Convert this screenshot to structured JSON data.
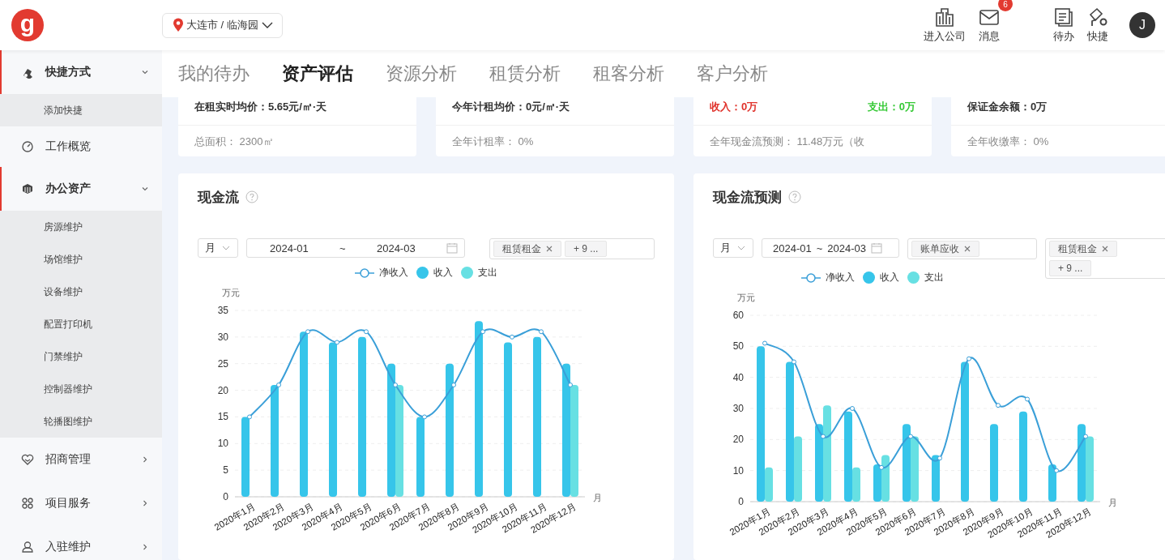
{
  "header": {
    "logo": "g",
    "location": "大连市 / 临海园",
    "actions": [
      {
        "label": "进入公司"
      },
      {
        "label": "消息",
        "badge": "6"
      },
      {
        "label": "待办"
      },
      {
        "label": "快捷"
      }
    ],
    "avatar": "J"
  },
  "sidebar": {
    "items": [
      {
        "kind": "group",
        "label": "快捷方式",
        "expanded": true,
        "children": [
          {
            "label": "添加快捷"
          }
        ]
      },
      {
        "kind": "link",
        "label": "工作概览"
      },
      {
        "kind": "group",
        "label": "办公资产",
        "expanded": true,
        "children": [
          {
            "label": "房源维护"
          },
          {
            "label": "场馆维护"
          },
          {
            "label": "设备维护"
          },
          {
            "label": "配置打印机"
          },
          {
            "label": "门禁维护"
          },
          {
            "label": "控制器维护"
          },
          {
            "label": "轮播图维护"
          }
        ]
      },
      {
        "kind": "group",
        "label": "招商管理",
        "expanded": false
      },
      {
        "kind": "group",
        "label": "项目服务",
        "expanded": false
      },
      {
        "kind": "group",
        "label": "入驻维护",
        "expanded": false
      }
    ]
  },
  "tabs": [
    {
      "label": "我的待办",
      "selected": false
    },
    {
      "label": "资产评估",
      "selected": true
    },
    {
      "label": "资源分析",
      "selected": false
    },
    {
      "label": "租赁分析",
      "selected": false
    },
    {
      "label": "租客分析",
      "selected": false
    },
    {
      "label": "客户分析",
      "selected": false
    }
  ],
  "stat_cards": [
    {
      "top": [
        {
          "text": "在租实时均价：5.65元/㎡·天",
          "color": "#333333"
        }
      ],
      "bottom": "总面积：  2300㎡"
    },
    {
      "top": [
        {
          "text": "今年计租均价：0元/㎡·天",
          "color": "#333333"
        }
      ],
      "bottom": "全年计租率：  0%"
    },
    {
      "top": [
        {
          "text": "收入：0万",
          "color": "#e0322b"
        },
        {
          "text": "支出：0万",
          "color": "#35c935"
        }
      ],
      "bottom": "全年现金流预测：  11.48万元（收"
    },
    {
      "top": [
        {
          "text": "保证金余额：0万",
          "color": "#333333"
        }
      ],
      "bottom": "全年收缴率：  0%"
    }
  ],
  "panels": [
    {
      "title": "现金流",
      "filters": [
        {
          "kind": "select",
          "value": "月"
        },
        {
          "kind": "range",
          "start": "2024-01",
          "separator": "~",
          "end": "2024-03",
          "wide": true
        },
        {
          "kind": "tags",
          "tags": [
            {
              "label": "租赁租金",
              "closable": true
            },
            {
              "label": "+ 9 ...",
              "closable": false
            }
          ],
          "wrap": false
        }
      ],
      "chart_data": {
        "type": "bar",
        "ylabel": "万元",
        "xlabel": "月",
        "grid": true,
        "categories": [
          "2020年1月",
          "2020年2月",
          "2020年3月",
          "2020年4月",
          "2020年5月",
          "2020年6月",
          "2020年7月",
          "2020年8月",
          "2020年9月",
          "2020年10月",
          "2020年11月",
          "2020年12月"
        ],
        "ylim": [
          0,
          35
        ],
        "yticks": [
          0,
          5,
          10,
          15,
          20,
          25,
          30,
          35
        ],
        "series": [
          {
            "name": "净收入",
            "type": "line",
            "marker": true,
            "color": "#3a9fd8",
            "values": [
              15,
              21,
              31,
              29,
              31,
              21,
              15,
              21,
              31,
              30,
              31,
              21
            ]
          },
          {
            "name": "收入",
            "type": "bar",
            "color": "#36c5ea",
            "values": [
              15,
              21,
              31,
              29,
              30,
              25,
              15,
              25,
              33,
              29,
              30,
              25
            ]
          },
          {
            "name": "支出",
            "type": "bar",
            "color": "#67e0e3",
            "values": [
              null,
              null,
              null,
              null,
              null,
              21,
              null,
              null,
              null,
              null,
              null,
              21
            ]
          }
        ]
      }
    },
    {
      "title": "现金流预测",
      "filters": [
        {
          "kind": "select",
          "value": "月"
        },
        {
          "kind": "range",
          "start": "2024-01",
          "separator": "~",
          "end": "2024-03",
          "wide": false
        },
        {
          "kind": "tags",
          "tags": [
            {
              "label": "账单应收",
              "closable": true
            }
          ],
          "wrap": false
        },
        {
          "kind": "tags",
          "tags": [
            {
              "label": "租赁租金",
              "closable": true
            },
            {
              "label": "+ 9 ...",
              "closable": false
            }
          ],
          "wrap": true
        }
      ],
      "chart_data": {
        "type": "bar",
        "ylabel": "万元",
        "xlabel": "月",
        "grid": true,
        "categories": [
          "2020年1月",
          "2020年2月",
          "2020年3月",
          "2020年4月",
          "2020年5月",
          "2020年6月",
          "2020年7月",
          "2020年8月",
          "2020年9月",
          "2020年10月",
          "2020年11月",
          "2020年12月"
        ],
        "ylim": [
          0,
          60
        ],
        "yticks": [
          0,
          10,
          20,
          30,
          40,
          50,
          60
        ],
        "series": [
          {
            "name": "净收入",
            "type": "line",
            "marker": true,
            "color": "#3a9fd8",
            "values": [
              51,
              45,
              21,
              30,
              11,
              21,
              14,
              46,
              31,
              33,
              10,
              21
            ]
          },
          {
            "name": "收入",
            "type": "bar",
            "color": "#36c5ea",
            "values": [
              50,
              45,
              25,
              29,
              12,
              25,
              15,
              45,
              25,
              29,
              12,
              25
            ]
          },
          {
            "name": "支出",
            "type": "bar",
            "color": "#67e0e3",
            "values": [
              11,
              21,
              31,
              11,
              15,
              21,
              null,
              null,
              null,
              null,
              null,
              21
            ]
          }
        ]
      }
    }
  ]
}
